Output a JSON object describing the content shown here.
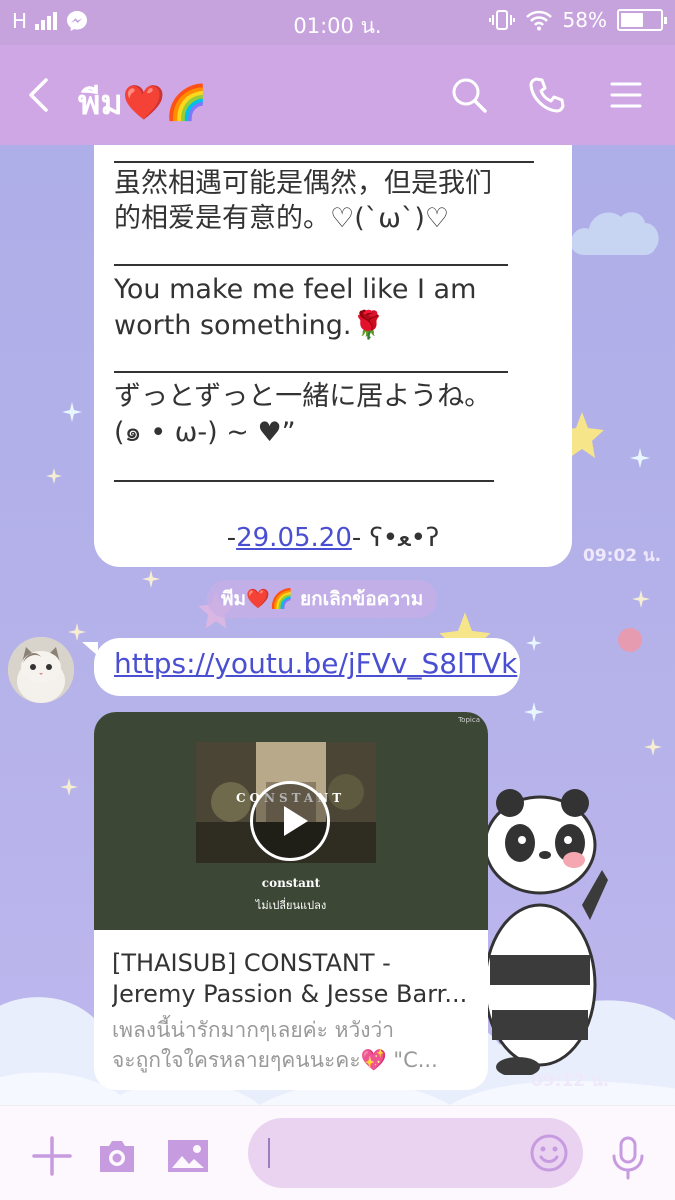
{
  "status_bar": {
    "network": "H",
    "time": "01:00 น.",
    "battery": "58%",
    "battery_level": 0.58
  },
  "header": {
    "title": "พีม❤️🌈"
  },
  "messages": {
    "quote": {
      "line1": "虽然相遇可能是偶然，但是我们",
      "line2": "的相爱是有意的。♡(`ω`)♡",
      "line3": "You make me feel like I am",
      "line4": "worth something.🌹",
      "line5": "ずっとずっと一緒に居ようね。",
      "line6": "(๑ • ω-) ~ ♥”",
      "signature_prefix": "-",
      "signature_date": "29.05.20",
      "signature_suffix": "- ʕ•ﻌ•ʔ",
      "time": "09:02 น."
    },
    "system": "พีม❤️🌈 ยกเลิกข้อความ",
    "link": {
      "url": "https://youtu.be/jFVv_S8lTVk"
    },
    "card": {
      "thumb_brand": "Topica",
      "thumb_word": "CONSTANT",
      "song_title": "constant",
      "song_subtitle": "ไม่เปลี่ยนแปลง",
      "title_line1": "[THAISUB] CONSTANT -",
      "title_line2": "Jeremy Passion & Jesse Barr...",
      "desc_line1": "เพลงนี้น่ารักมากๆเลยค่ะ หวังว่า",
      "desc_line2": "จะถูกใจใครหลายๆคนนะคะ💖 \"C...",
      "time": "09:12 น."
    }
  },
  "colors": {
    "header": "#cfa7e4",
    "status": "#c7a3de",
    "link": "#4a4fd1",
    "accent": "#c79be0"
  },
  "icons": {
    "back": "chevron-left-icon",
    "search": "search-icon",
    "call": "phone-icon",
    "menu": "menu-icon",
    "add": "plus-icon",
    "camera": "camera-icon",
    "gallery": "image-icon",
    "emoji": "emoji-icon",
    "mic": "microphone-icon"
  }
}
